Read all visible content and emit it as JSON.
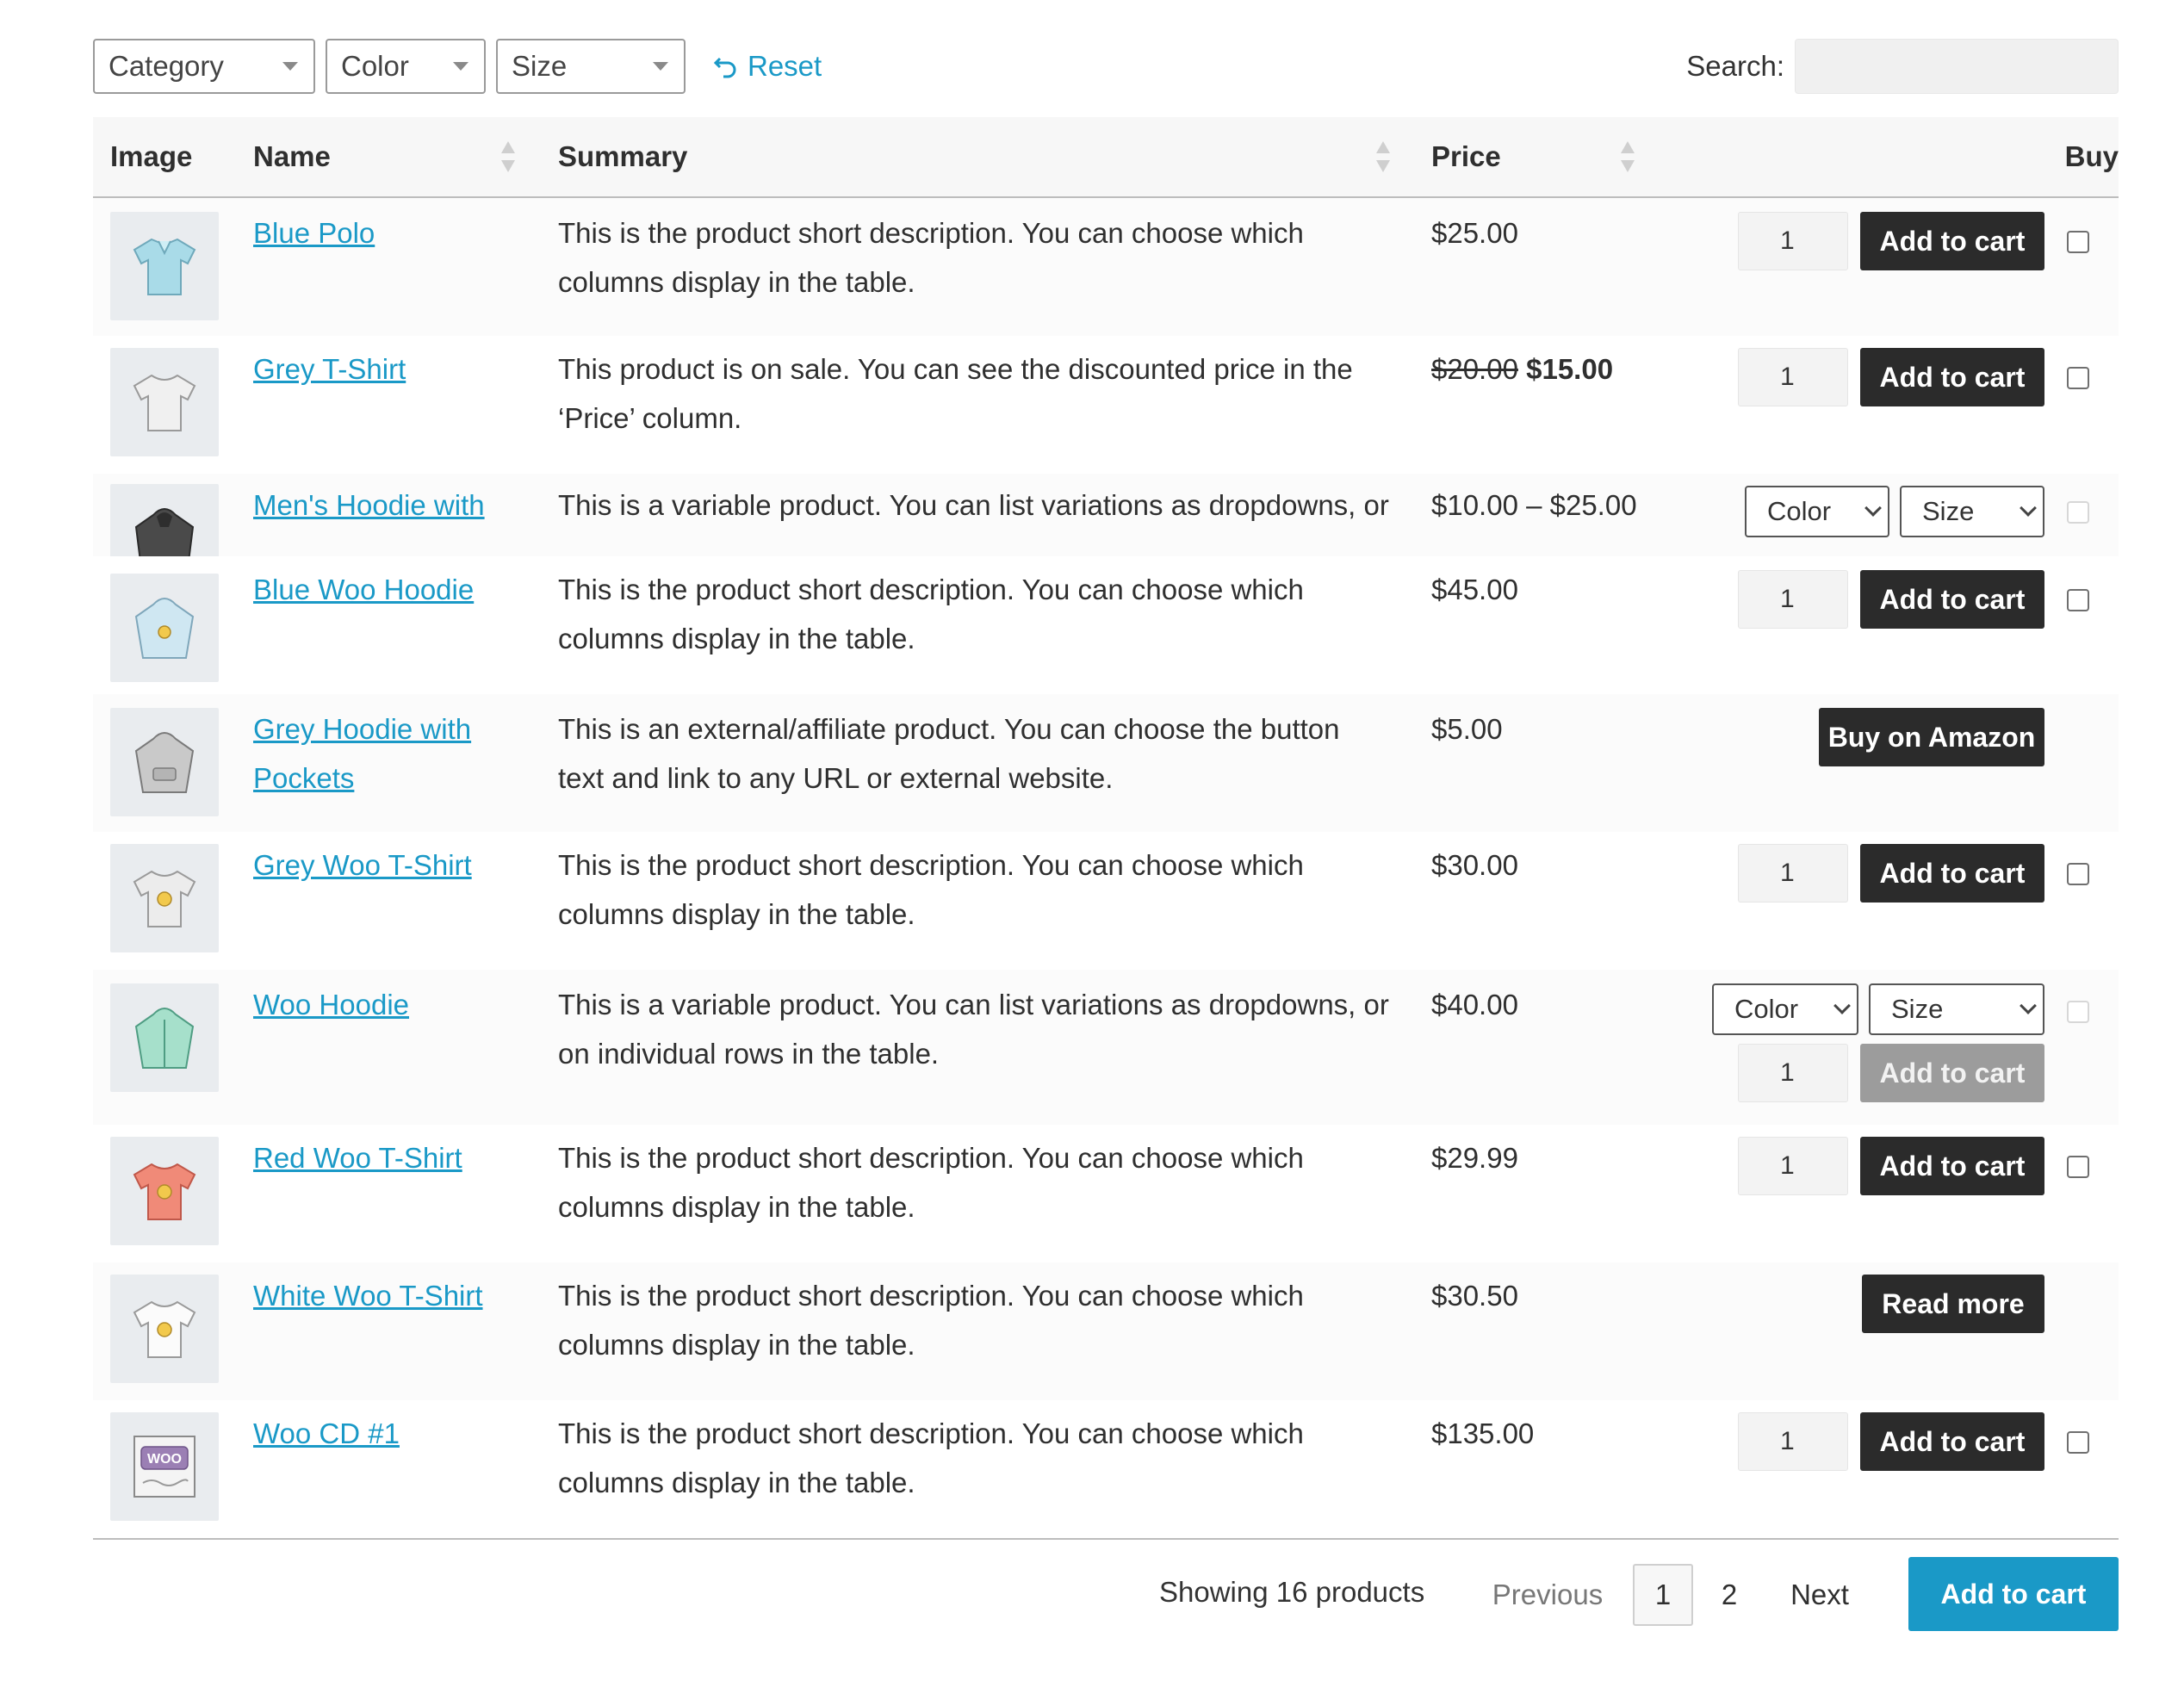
{
  "filters": {
    "category": "Category",
    "color": "Color",
    "size": "Size",
    "reset": "Reset",
    "search_label": "Search:",
    "search_value": ""
  },
  "table": {
    "headers": {
      "image": "Image",
      "name": "Name",
      "summary": "Summary",
      "price": "Price",
      "buy": "Buy"
    },
    "rows": [
      {
        "name": "Blue Polo",
        "summary_1": "This is the product short description. You can choose which",
        "summary_2": "columns display in the table.",
        "price": "$25.00",
        "qty": "1",
        "button": "Add to cart",
        "image_icon": "blue-polo-shirt-icon"
      },
      {
        "name": "Grey T-Shirt",
        "summary_1": "This product is on sale. You can see the discounted price in the",
        "summary_2": "‘Price’ column.",
        "price_old": "$20.00",
        "price_new": "$15.00",
        "qty": "1",
        "button": "Add to cart",
        "image_icon": "grey-tshirt-icon"
      },
      {
        "name_1": "Men's Hoodie with",
        "summary_1": "This is a variable product. You can list variations as dropdowns, or",
        "price": "$10.00 – $25.00",
        "color_select": "Color",
        "size_select": "Size",
        "image_icon": "dark-hoodie-icon"
      },
      {
        "name": "Blue Woo Hoodie",
        "summary_1": "This is the product short description. You can choose which",
        "summary_2": "columns display in the table.",
        "price": "$45.00",
        "qty": "1",
        "button": "Add to cart",
        "image_icon": "blue-hoodie-icon"
      },
      {
        "name_1": "Grey Hoodie with",
        "name_2": "Pockets",
        "summary_1": "This is an external/affiliate product. You can choose the button",
        "summary_2": "text and link to any URL or external website.",
        "price": "$5.00",
        "button": "Buy on Amazon",
        "image_icon": "grey-hoodie-icon"
      },
      {
        "name": "Grey Woo T-Shirt",
        "summary_1": "This is the product short description. You can choose which",
        "summary_2": "columns display in the table.",
        "price": "$30.00",
        "qty": "1",
        "button": "Add to cart",
        "image_icon": "grey-woo-tshirt-icon"
      },
      {
        "name": "Woo Hoodie",
        "summary_1": "This is a variable product. You can list variations as dropdowns, or",
        "summary_2": "on individual rows in the table.",
        "price": "$40.00",
        "color_select": "Color",
        "size_select": "Size",
        "qty": "1",
        "button": "Add to cart",
        "image_icon": "green-hoodie-icon"
      },
      {
        "name": "Red Woo T-Shirt",
        "summary_1": "This is the product short description. You can choose which",
        "summary_2": "columns display in the table.",
        "price": "$29.99",
        "qty": "1",
        "button": "Add to cart",
        "image_icon": "red-tshirt-icon"
      },
      {
        "name": "White Woo T-Shirt",
        "summary_1": "This is the product short description. You can choose which",
        "summary_2": "columns display in the table.",
        "price": "$30.50",
        "button": "Read more",
        "image_icon": "white-tshirt-icon"
      },
      {
        "name": "Woo CD #1",
        "summary_1": "This is the product short description. You can choose which",
        "summary_2": "columns display in the table.",
        "price": "$135.00",
        "qty": "1",
        "button": "Add to cart",
        "image_icon": "woo-cd-icon"
      }
    ]
  },
  "footer": {
    "showing": "Showing 16 products",
    "previous": "Previous",
    "page_1": "1",
    "page_2": "2",
    "next": "Next",
    "add_to_cart": "Add to cart"
  },
  "colors": {
    "link": "#1a99c7",
    "button": "#2b2b2b",
    "primary": "#1a99c7",
    "disabled": "#9c9c9c"
  }
}
